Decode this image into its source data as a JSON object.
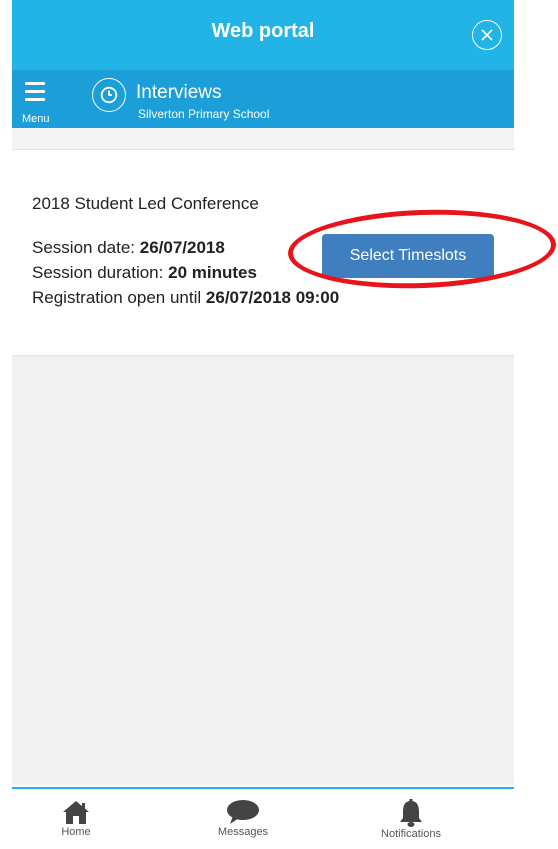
{
  "header": {
    "title": "Web portal"
  },
  "nav": {
    "menu_label": "Menu",
    "section_title": "Interviews",
    "section_subtitle": "Silverton Primary School"
  },
  "conference": {
    "title": "2018 Student Led Conference",
    "session_date_label": "Session date:",
    "session_date_value": "26/07/2018",
    "session_duration_label": "Session duration:",
    "session_duration_value": "20 minutes",
    "registration_label": "Registration open until",
    "registration_value": "26/07/2018 09:00",
    "select_button": "Select Timeslots"
  },
  "tabs": [
    {
      "label": "Home",
      "icon": "home-icon"
    },
    {
      "label": "Messages",
      "icon": "chat-bubble-icon"
    },
    {
      "label": "Notifications",
      "icon": "bell-icon"
    }
  ],
  "colors": {
    "header_bg": "#22b4e6",
    "nav_bg": "#1c9fd9",
    "button_bg": "#3f7fc0",
    "annotation": "#e8141b"
  }
}
